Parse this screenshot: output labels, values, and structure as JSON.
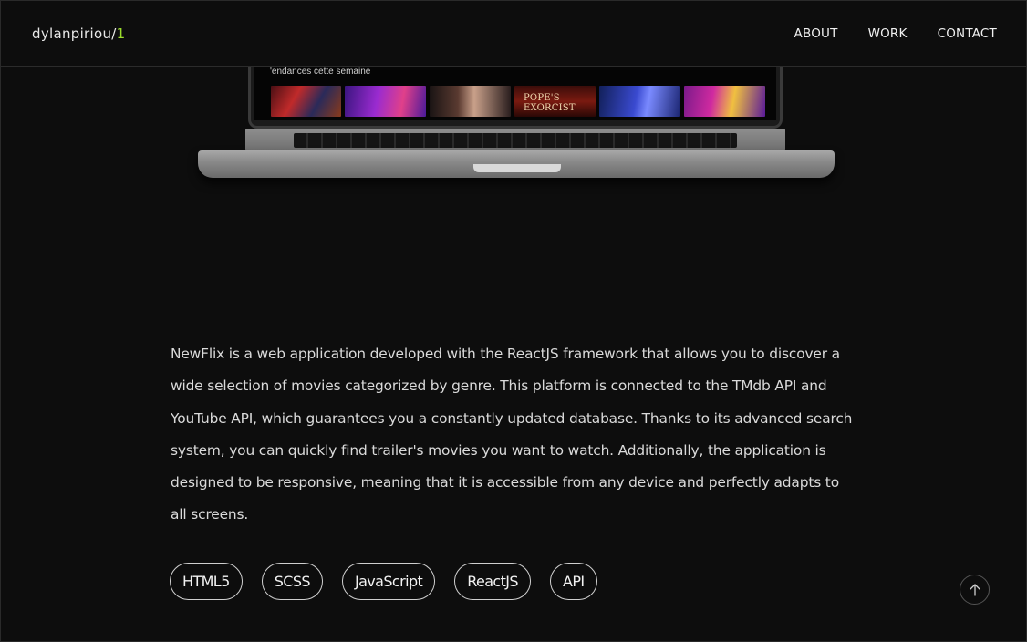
{
  "header": {
    "logo_name": "dylanpiriou",
    "logo_slash": "/",
    "logo_number": "1",
    "nav": [
      {
        "label": "ABOUT"
      },
      {
        "label": "WORK"
      },
      {
        "label": "CONTACT"
      }
    ]
  },
  "mockup": {
    "caption": "'endances cette semaine",
    "posters": [
      {
        "title": ""
      },
      {
        "title": ""
      },
      {
        "title": ""
      },
      {
        "title": "POPE'S EXORCIST"
      },
      {
        "title": ""
      },
      {
        "title": ""
      }
    ]
  },
  "project": {
    "description": "NewFlix is a web application developed with the ReactJS framework that allows you to discover a wide selection of movies categorized by genre. This platform is connected to the TMdb API and YouTube API, which guarantees you a constantly updated database. Thanks to its advanced search system, you can quickly find trailer's movies you want to watch. Additionally, the application is designed to be responsive, meaning that it is accessible from any device and perfectly adapts to all screens.",
    "tags": [
      "HTML5",
      "SCSS",
      "JavaScript",
      "ReactJS",
      "API"
    ]
  },
  "icons": {
    "back_to_top": "arrow-up-icon"
  },
  "colors": {
    "background": "#0d0d0d",
    "accent": "#9bdc2c",
    "text": "#dadada"
  }
}
